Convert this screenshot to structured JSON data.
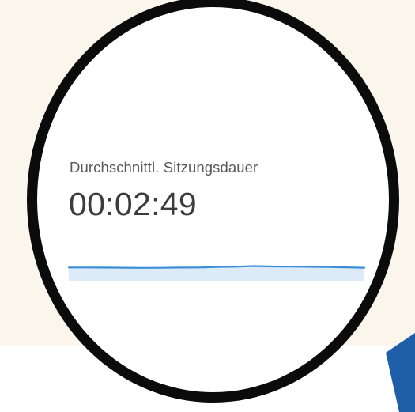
{
  "metric": {
    "title": "Durchschnittl. Sitzungsdauer",
    "value": "00:02:49",
    "sparkline": [
      0.48,
      0.48,
      0.47,
      0.46,
      0.44,
      0.45,
      0.47,
      0.48,
      0.52,
      0.55,
      0.61,
      0.57,
      0.56,
      0.54,
      0.53,
      0.49,
      0.46
    ],
    "line_color": "#3b8fd8",
    "fill_color": "#dcebf7"
  },
  "colors": {
    "background": "#fbf6ec",
    "ring": "#0b0b0b",
    "arrow": "#1f5ea8"
  }
}
